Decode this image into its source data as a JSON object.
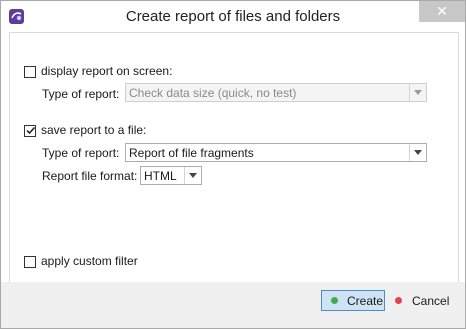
{
  "window": {
    "title": "Create report of files and folders",
    "close_glyph": "✕"
  },
  "display_report": {
    "checkbox_label": "display report on screen:",
    "checked": false,
    "type_label": "Type of report:",
    "type_value": "Check data size (quick, no test)",
    "enabled": false
  },
  "save_report": {
    "checkbox_label": "save report to a file:",
    "checked": true,
    "type_label": "Type of report:",
    "type_value": "Report of file fragments",
    "format_label": "Report file format:",
    "format_value": "HTML"
  },
  "custom_filter": {
    "checkbox_label": "apply custom filter",
    "checked": false
  },
  "footer": {
    "create_label": "Create",
    "cancel_label": "Cancel",
    "create_dot_color": "#3fae49",
    "cancel_dot_color": "#e0444c"
  },
  "icons": {
    "app": "app-logo-icon",
    "close": "close-icon",
    "dropdown": "chevron-down-icon",
    "check": "checkmark-icon"
  }
}
